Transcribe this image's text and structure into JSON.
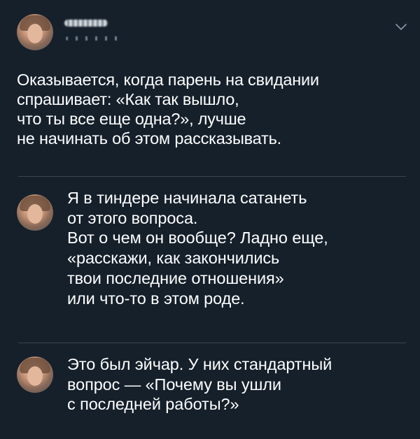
{
  "tweet": {
    "text": "Оказывается, когда парень на свидании\nспрашивает: «Как так вышло,\nчто ты все еще одна?», лучше\nне начинать об этом рассказывать."
  },
  "replies": [
    {
      "text": "Я в тиндере начинала сатанеть\nот этого вопроса.\nВот о чем он вообще? Ладно еще,\n«расскажи, как закончились\nтвои последние отношения»\nили что-то в этом роде."
    },
    {
      "text": "Это был эйчар. У них стандартный\nвопрос — «Почему вы ушли\nс последней работы?»"
    }
  ],
  "icons": {
    "menu": "chevron-down-icon",
    "avatar": "avatar"
  },
  "colors": {
    "background": "#15202b",
    "text": "#ffffff",
    "divider": "#38444d",
    "secondary": "#8899a6"
  }
}
